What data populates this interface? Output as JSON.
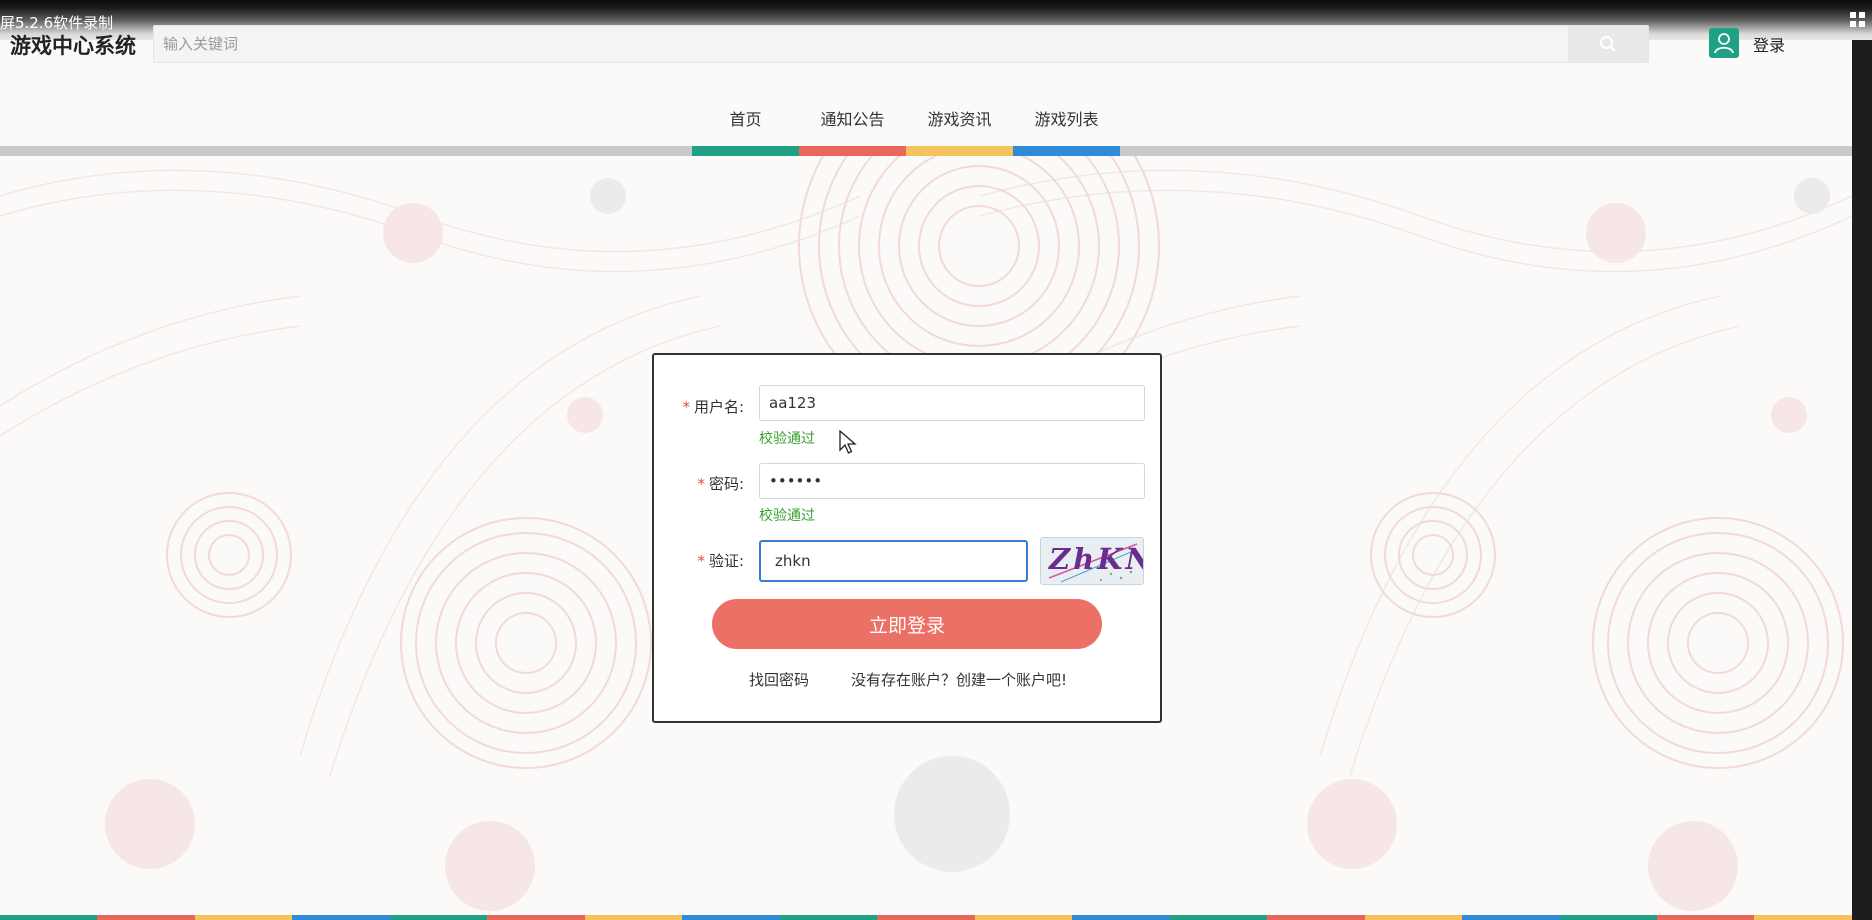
{
  "recorder": {
    "label": "屏5.2.6软件录制"
  },
  "header": {
    "site_title": "游戏中心系统",
    "search": {
      "placeholder": "输入关键词",
      "value": "",
      "button_icon": "search-icon"
    },
    "user": {
      "avatar_icon": "user-icon",
      "login_label": "登录"
    }
  },
  "nav": {
    "items": [
      {
        "label": "首页",
        "color": "#1ea185"
      },
      {
        "label": "通知公告",
        "color": "#e8665a"
      },
      {
        "label": "游戏资讯",
        "color": "#f4c35c"
      },
      {
        "label": "游戏列表",
        "color": "#2f8ad8"
      }
    ]
  },
  "login_form": {
    "username": {
      "label": "用户名:",
      "value": "aa123",
      "validation": "校验通过"
    },
    "password": {
      "label": "密码:",
      "value": "aa1234",
      "validation": "校验通过"
    },
    "captcha": {
      "label": "验证:",
      "value": "zhkn",
      "image_text": "ZhKN"
    },
    "submit_label": "立即登录",
    "forgot_link": "找回密码",
    "register_link": "没有存在账户？创建一个账户吧!"
  },
  "colors": {
    "accent": "#eb7066",
    "valid": "#3aa12e",
    "required": "#e84c3d"
  }
}
